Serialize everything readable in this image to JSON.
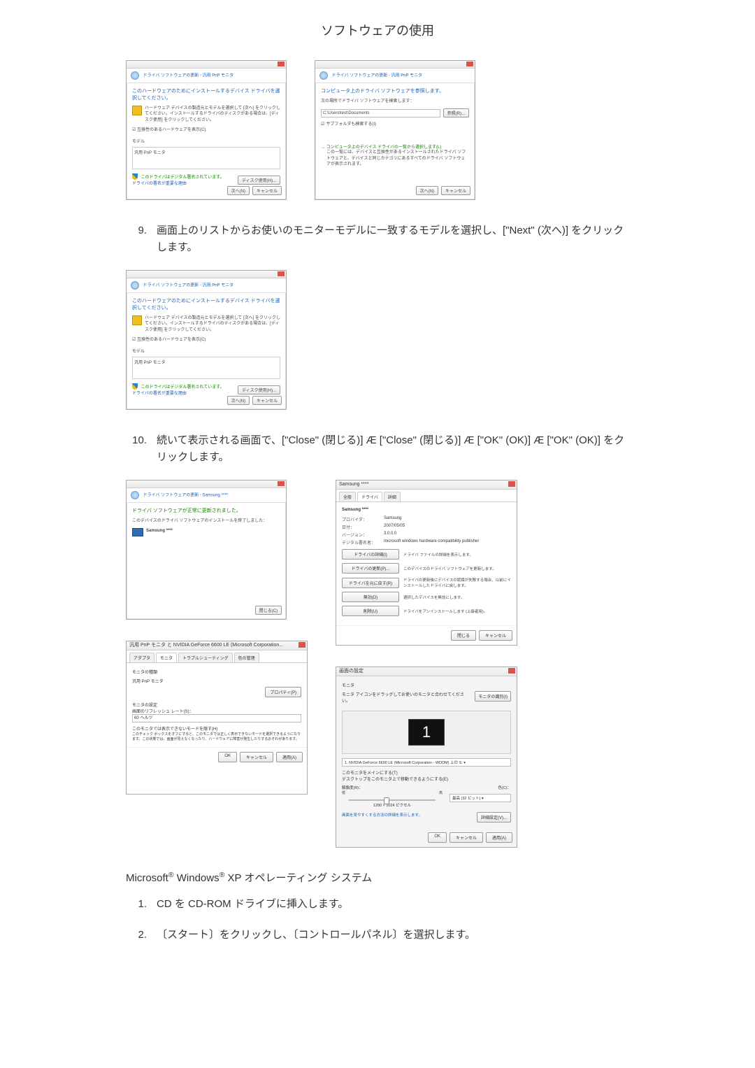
{
  "page_title": "ソフトウェアの使用",
  "wiz1": {
    "crumb": "ドライバ ソフトウェアの更新 - 汎用 PnP モニタ",
    "heading": "このハードウェアのためにインストールするデバイス ドライバを選択してください。",
    "para": "ハードウェア デバイスの製造元とモデルを選択して [次へ] をクリックしてください。インストールするドライバのディスクがある場合は、[ディスク使用] をクリックしてください。",
    "compat_label": "☑ 互換性のあるハードウェアを表示(C)",
    "model_label": "モデル",
    "model_item": "汎用 PnP モニタ",
    "sig_text": "このドライバはデジタル署名されています。",
    "sig_link": "ドライバの署名が重要な理由",
    "disk_btn": "ディスク使用(H)...",
    "next_btn": "次へ(N)",
    "cancel_btn": "キャンセル"
  },
  "wiz2": {
    "crumb": "ドライバ ソフトウェアの更新 - 汎用 PnP モニタ",
    "heading": "コンピュータ上のドライバ ソフトウェアを参照します。",
    "label": "次の場所でドライバ ソフトウェアを検索します：",
    "path": "C:\\Users\\test\\Documents",
    "browse_btn": "参照(R)...",
    "subfolder": "サブフォルダも検索する(I)",
    "option_title": "コンピュータ上のデバイス ドライバの一覧から選択します(L)",
    "option_desc": "この一覧には、デバイスと互換性があるインストールされたドライバ ソフトウェアと、デバイスと同じカテゴリにあるすべてのドライバ ソフトウェアが表示されます。",
    "next_btn": "次へ(N)",
    "cancel_btn": "キャンセル"
  },
  "step9": {
    "num": "9.",
    "text": "画面上のリストからお使いのモニターモデルに一致するモデルを選択し、[\"Next\" (次へ)] をクリックします。"
  },
  "wiz3": {
    "crumb": "ドライバ ソフトウェアの更新 - 汎用 PnP モニタ",
    "heading": "このハードウェアのためにインストールするデバイス ドライバを選択してください。",
    "para": "ハードウェア デバイスの製造元とモデルを選択して [次へ] をクリックしてください。インストールするドライバのディスクがある場合は、[ディスク使用] をクリックしてください。",
    "compat_label": "☑ 互換性のあるハードウェアを表示(C)",
    "model_label": "モデル",
    "model_item": "汎用 PnP モニタ",
    "sig_text": "このドライバはデジタル署名されています。",
    "sig_link": "ドライバの署名が重要な理由",
    "disk_btn": "ディスク使用(H)...",
    "next_btn": "次へ(N)",
    "cancel_btn": "キャンセル"
  },
  "step10": {
    "num": "10.",
    "text": "続いて表示される画面で、[\"Close\" (閉じる)]  Æ  [\"Close\" (閉じる)]  Æ  [\"OK\" (OK)]  Æ  [\"OK\" (OK)] をクリックします。"
  },
  "wiz4": {
    "crumb": "ドライバ ソフトウェアの更新 - Samsung ****",
    "heading": "ドライバ ソフトウェアが正常に更新されました。",
    "para": "このデバイスのドライバ ソフトウェアのインストールを終了しました：",
    "device": "Samsung ****",
    "close_btn": "閉じる(C)"
  },
  "prop1": {
    "title": "Samsung ****",
    "tabs": [
      "全般",
      "ドライバ",
      "詳細"
    ],
    "device": "Samsung ****",
    "kv": {
      "provider_k": "プロバイダ：",
      "provider_v": "Samsung",
      "date_k": "日付：",
      "date_v": "2007/05/05",
      "version_k": "バージョン：",
      "version_v": "3.0.0.0",
      "signer_k": "デジタル署名者：",
      "signer_v": "microsoft windows hardware compatibility publisher"
    },
    "buttons": {
      "details": "ドライバの詳細(I)",
      "details_desc": "ドライバ ファイルの詳細を表示します。",
      "update": "ドライバの更新(P)...",
      "update_desc": "このデバイスのドライバ ソフトウェアを更新します。",
      "rollback": "ドライバを元に戻す(R)",
      "rollback_desc": "ドライバの更新後にデバイスの認識が失敗する場合、以前にインストールしたドライバに戻します。",
      "disable": "無効(D)",
      "disable_desc": "選択したデバイスを無効にします。",
      "uninstall": "削除(U)",
      "uninstall_desc": "ドライバをアンインストールします (上級者用)。"
    },
    "close": "閉じる",
    "cancel": "キャンセル"
  },
  "prop2": {
    "title": "汎用 PnP モニタ と NVIDIA GeForce 6600 LE (Microsoft Corporation...",
    "tabs": [
      "アダプタ",
      "モニタ",
      "トラブルシューティング",
      "色の管理"
    ],
    "group": "モニタの種類",
    "device": "汎用 PnP モニタ",
    "prop_btn": "プロパティ(P)",
    "group2": "モニタの設定",
    "refresh_label": "画面のリフレッシュ レート(S)：",
    "refresh_value": "60 ヘルツ",
    "hide": "このモニタでは表示できないモードを隠す(H)",
    "hide_desc": "このチェック ボックスをオフにすると、このモニタでは正しく表示できないモードを選択できるようになります。この状態では、画面が見えなくなったり、ハードウェアに障害が発生したりするおそれがあります。",
    "ok": "OK",
    "cancel": "キャンセル",
    "apply": "適用(A)"
  },
  "disp": {
    "title": "画面の設定",
    "group": "モニタ",
    "info": "モニタ アイコンをドラッグしてお使いのモニタと合わせてください。",
    "identify_btn": "モニタの識別(I)",
    "monitor_num": "1",
    "select": "1. NVIDIA GeForce 6600 LE (Microsoft Corporation - WDDM) 上の S. ▾",
    "chk1": "このモニタをメインにする(T)",
    "chk2": "デスクトップをこのモニタ上で移動できるようにする(E)",
    "res_label": "解像度(R)：",
    "color_label": "色(C)：",
    "res_low": "低",
    "res_high": "高",
    "res_value": "1280 × 1024 ピクセル",
    "color_value": "最高 (32 ビット) ▾",
    "adv_link": "画面を見やすくする方法の詳細を表示します。",
    "adv_btn": "詳細設定(V)...",
    "ok": "OK",
    "cancel": "キャンセル",
    "apply": "適用(A)"
  },
  "xp_header_1": "Microsoft",
  "xp_header_2": " Windows",
  "xp_header_3": " XP オペレーティング システム",
  "xp_step1": {
    "num": "1.",
    "text": "CD を CD-ROM ドライブに挿入します。"
  },
  "xp_step2": {
    "num": "2.",
    "text": "〔スタート〕をクリックし、〔コントロールパネル〕を選択します。"
  }
}
